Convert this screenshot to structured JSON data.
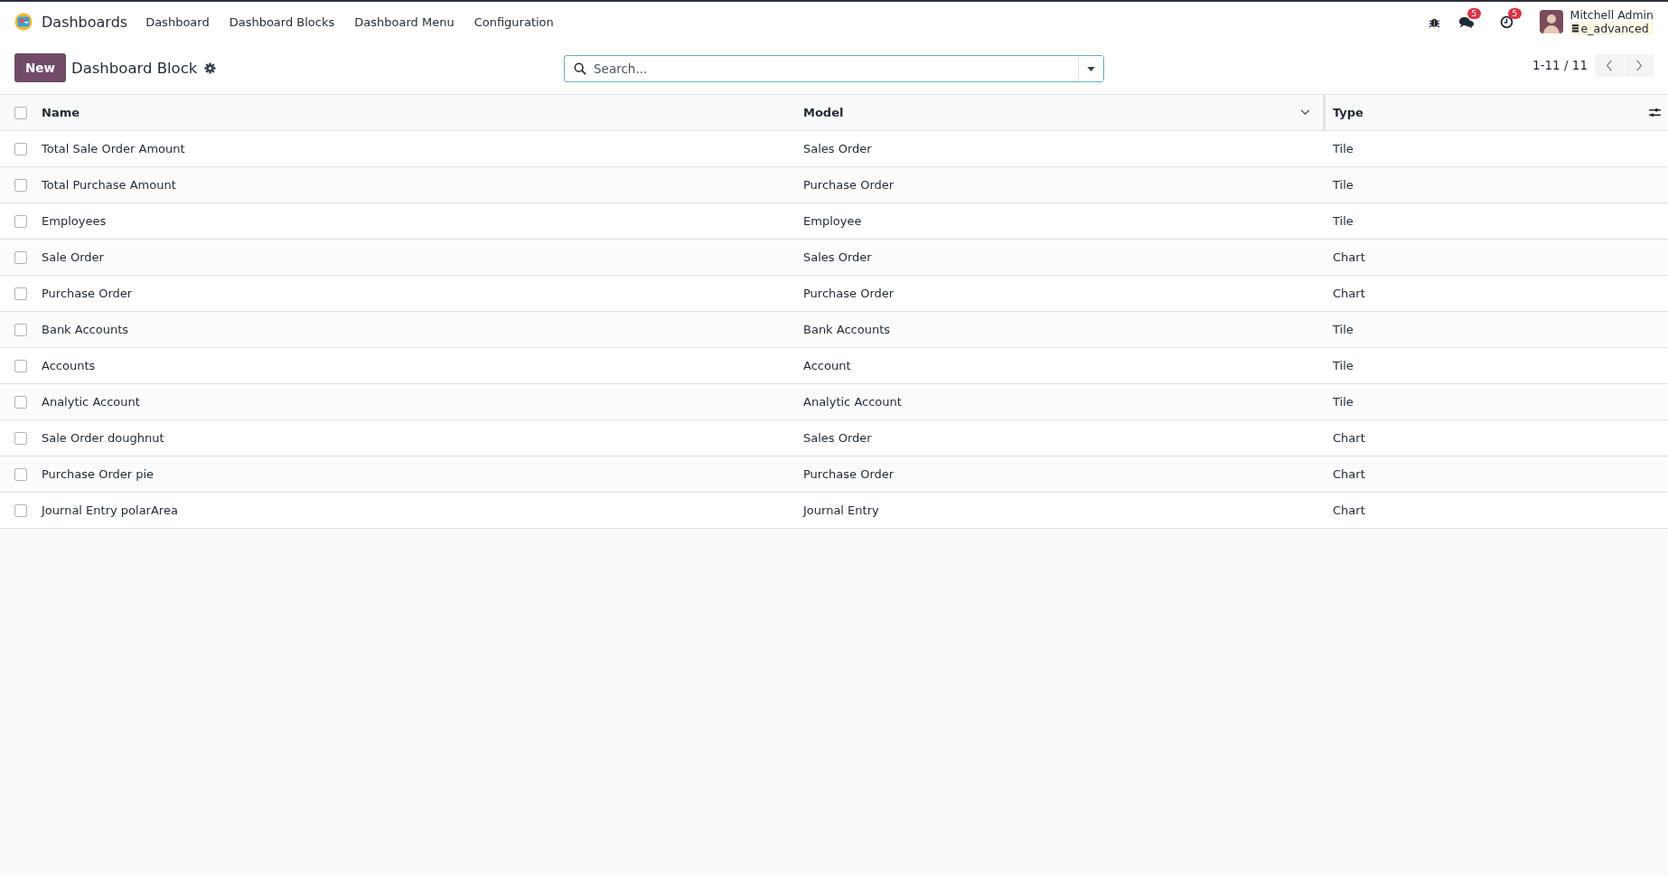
{
  "navbar": {
    "app_name": "Dashboards",
    "menu": [
      "Dashboard",
      "Dashboard Blocks",
      "Dashboard Menu",
      "Configuration"
    ],
    "messages_badge": "5",
    "activities_badge": "5",
    "user": {
      "name": "Mitchell Admin",
      "database": "e_advanced"
    }
  },
  "control_panel": {
    "new_button": "New",
    "title": "Dashboard Block",
    "search": {
      "placeholder": "Search..."
    },
    "pager": "1-11 / 11"
  },
  "table": {
    "select_all_checked": false,
    "columns": [
      "Name",
      "Model",
      "Type"
    ],
    "rows": [
      {
        "name": "Total Sale Order Amount",
        "model": "Sales Order",
        "type": "Tile",
        "checked": false
      },
      {
        "name": "Total Purchase Amount",
        "model": "Purchase Order",
        "type": "Tile",
        "checked": false
      },
      {
        "name": "Employees",
        "model": "Employee",
        "type": "Tile",
        "checked": false
      },
      {
        "name": "Sale Order",
        "model": "Sales Order",
        "type": "Chart",
        "checked": false
      },
      {
        "name": "Purchase Order",
        "model": "Purchase Order",
        "type": "Chart",
        "checked": false
      },
      {
        "name": "Bank Accounts",
        "model": "Bank Accounts",
        "type": "Tile",
        "checked": false
      },
      {
        "name": "Accounts",
        "model": "Account",
        "type": "Tile",
        "checked": false
      },
      {
        "name": "Analytic Account",
        "model": "Analytic Account",
        "type": "Tile",
        "checked": false
      },
      {
        "name": "Sale Order doughnut",
        "model": "Sales Order",
        "type": "Chart",
        "checked": false
      },
      {
        "name": "Purchase Order pie",
        "model": "Purchase Order",
        "type": "Chart",
        "checked": false
      },
      {
        "name": "Journal Entry polarArea",
        "model": "Journal Entry",
        "type": "Chart",
        "checked": false
      }
    ]
  }
}
